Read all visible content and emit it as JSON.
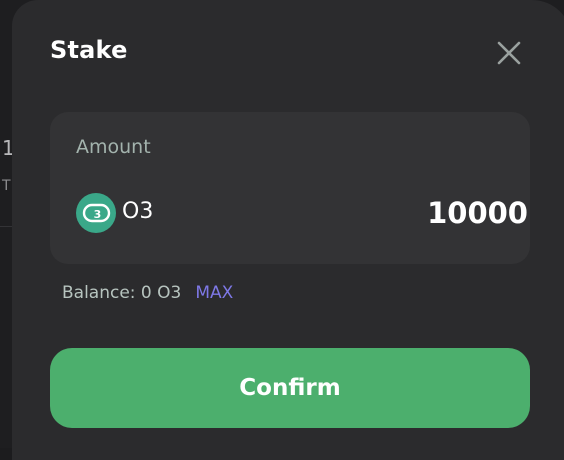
{
  "background": {
    "fragment_1": "1",
    "fragment_2": "T"
  },
  "modal": {
    "title": "Stake",
    "close_icon": "close-icon"
  },
  "amount_card": {
    "label": "Amount",
    "token": {
      "logo_icon": "o3-token-logo-icon",
      "logo_color": "#3aa889",
      "symbol": "O3"
    },
    "value": "10000"
  },
  "balance": {
    "text": "Balance: 0 O3",
    "max_label": "MAX"
  },
  "confirm": {
    "label": "Confirm",
    "color": "#4caf6d"
  },
  "colors": {
    "modal_bg": "#2b2b2d",
    "card_bg": "#333335",
    "max_link": "#7e78e6"
  }
}
